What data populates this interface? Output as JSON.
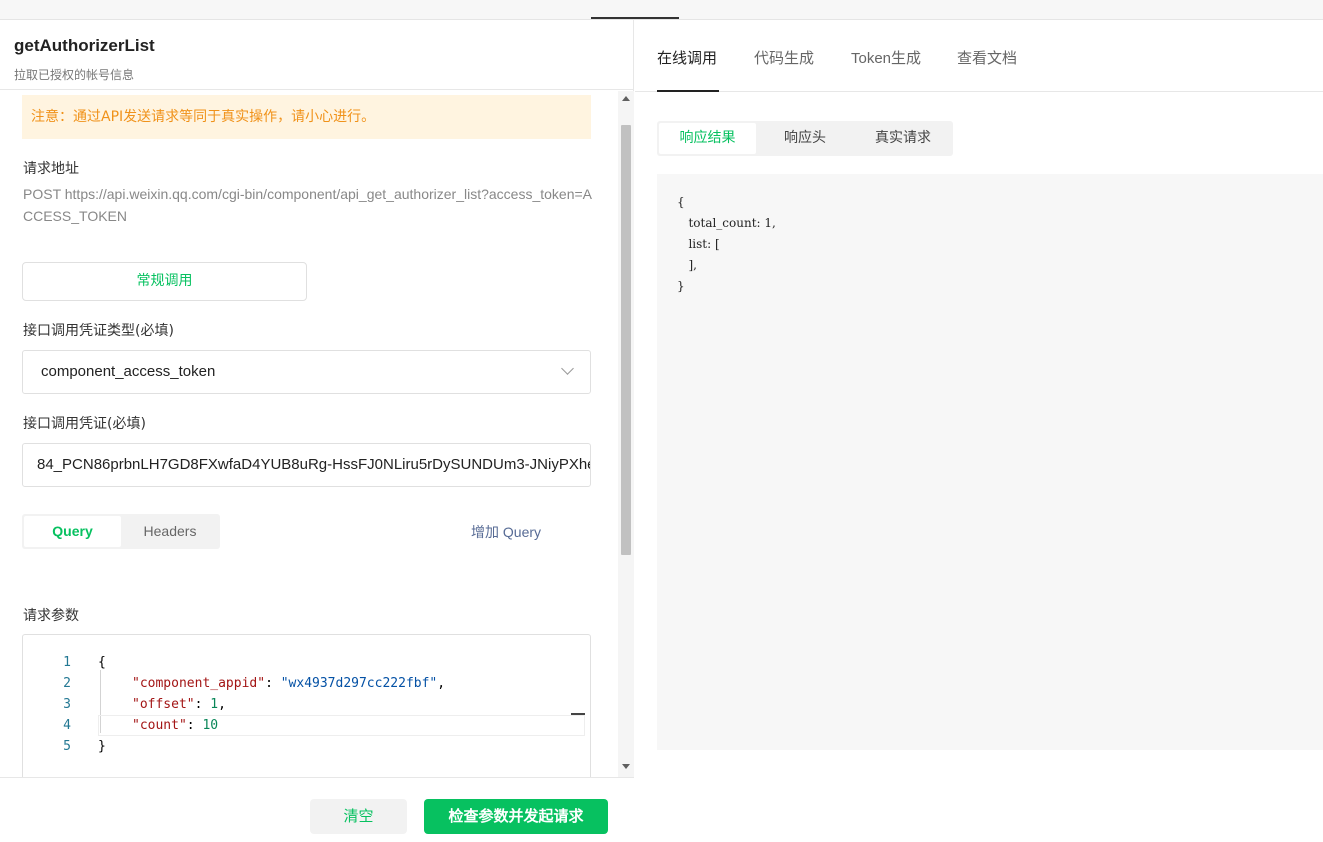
{
  "api": {
    "name": "getAuthorizerList",
    "description": "拉取已授权的帐号信息"
  },
  "notice": "注意：通过API发送请求等同于真实操作，请小心进行。",
  "request_url": {
    "label": "请求地址",
    "value": "POST https://api.weixin.qq.com/cgi-bin/component/api_get_authorizer_list?access_token=ACCESS_TOKEN"
  },
  "call_mode_button": "常规调用",
  "credential_type": {
    "label": "接口调用凭证类型(必填)",
    "selected": "component_access_token"
  },
  "credential": {
    "label": "接口调用凭证(必填)",
    "value": "84_PCN86prbnLH7GD8FXwfaD4YUB8uRg-HssFJ0NLiru5rDySUNDUm3-JNiyPXhe"
  },
  "param_tabs": [
    "Query",
    "Headers"
  ],
  "add_query": "增加 Query",
  "request_params": {
    "label": "请求参数",
    "line_numbers": [
      "1",
      "2",
      "3",
      "4",
      "5"
    ],
    "lines": [
      {
        "open": "{"
      },
      {
        "key": "\"component_appid\"",
        "sep": ": ",
        "val": "\"wx4937d297cc222fbf\"",
        "tail": ","
      },
      {
        "key": "\"offset\"",
        "sep": ": ",
        "val": "1",
        "tail": ","
      },
      {
        "key": "\"count\"",
        "sep": ": ",
        "val": "10",
        "tail": ""
      },
      {
        "close": "}"
      }
    ]
  },
  "footer": {
    "clear_button": "清空",
    "send_button": "检查参数并发起请求"
  },
  "right_tabs": [
    "在线调用",
    "代码生成",
    "Token生成",
    "查看文档"
  ],
  "result_tabs": [
    "响应结果",
    "响应头",
    "真实请求"
  ],
  "result_body": "{\n   total_count: 1,\n   list: [\n   ],\n}",
  "colors": {
    "accent": "#07c160",
    "notice_bg": "#fff4e0",
    "notice_text": "#f0921a",
    "link": "#576b95"
  }
}
